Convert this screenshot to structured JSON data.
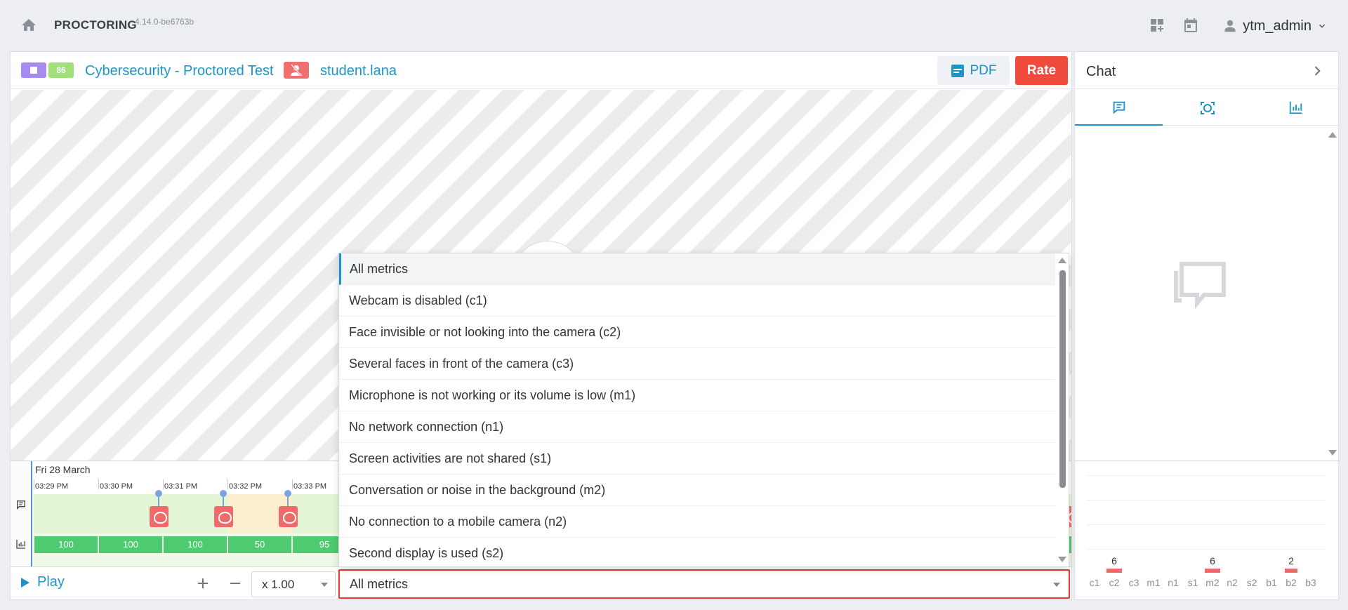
{
  "app": {
    "title": "PROCTORING",
    "version": "4.14.0-be6763b",
    "user_name": "ytm_admin"
  },
  "header": {
    "score": "86",
    "test_title": "Cybersecurity - Proctored Test",
    "student": "student.lana",
    "pdf_label": "PDF",
    "rate_label": "Rate"
  },
  "timeline": {
    "date": "Fri 28 March",
    "times": [
      "03:29 PM",
      "03:30 PM",
      "03:31 PM",
      "03:32 PM",
      "03:33 PM"
    ],
    "scores": [
      "100",
      "100",
      "100",
      "50",
      "95"
    ]
  },
  "controls": {
    "play_label": "Play",
    "speed": "x 1.00",
    "metric_selected": "All metrics"
  },
  "dropdown": {
    "options": [
      "All metrics",
      "Webcam is disabled (c1)",
      "Face invisible or not looking into the camera (c2)",
      "Several faces in front of the camera (c3)",
      "Microphone is not working or its volume is low (m1)",
      "No network connection (n1)",
      "Screen activities are not shared (s1)",
      "Conversation or noise in the background (m2)",
      "No connection to a mobile camera (n2)",
      "Second display is used (s2)"
    ]
  },
  "side": {
    "title": "Chat"
  },
  "chart_data": {
    "type": "bar",
    "categories": [
      "c1",
      "c2",
      "c3",
      "m1",
      "n1",
      "s1",
      "m2",
      "n2",
      "s2",
      "b1",
      "b2",
      "b3"
    ],
    "values": [
      0,
      6,
      0,
      0,
      0,
      0,
      6,
      0,
      0,
      0,
      2,
      0
    ],
    "bar_color": "#f06a6a"
  }
}
